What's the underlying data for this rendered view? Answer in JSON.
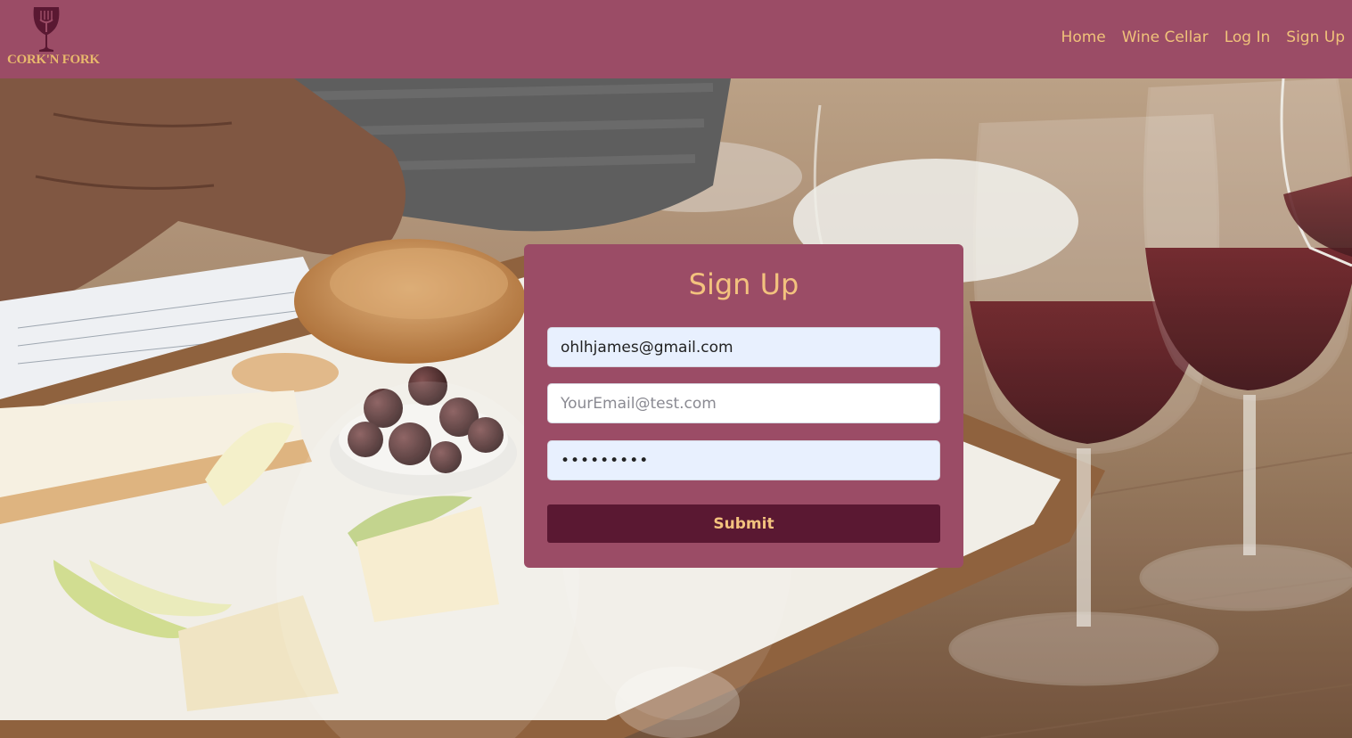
{
  "brand": {
    "logo_text": "CORK'N FORK",
    "colors": {
      "primary": "#9b4c66",
      "accent": "#f3c27e",
      "button": "#5a1832"
    }
  },
  "nav": {
    "items": [
      {
        "label": "Home"
      },
      {
        "label": "Wine Cellar"
      },
      {
        "label": "Log In"
      },
      {
        "label": "Sign Up"
      }
    ]
  },
  "form": {
    "title": "Sign Up",
    "email_value": "ohlhjames@gmail.com",
    "second_placeholder": "YourEmail@test.com",
    "password_value": "•••••••••",
    "submit_label": "Submit"
  },
  "background": {
    "icon": "wine-and-cheese-photo"
  }
}
